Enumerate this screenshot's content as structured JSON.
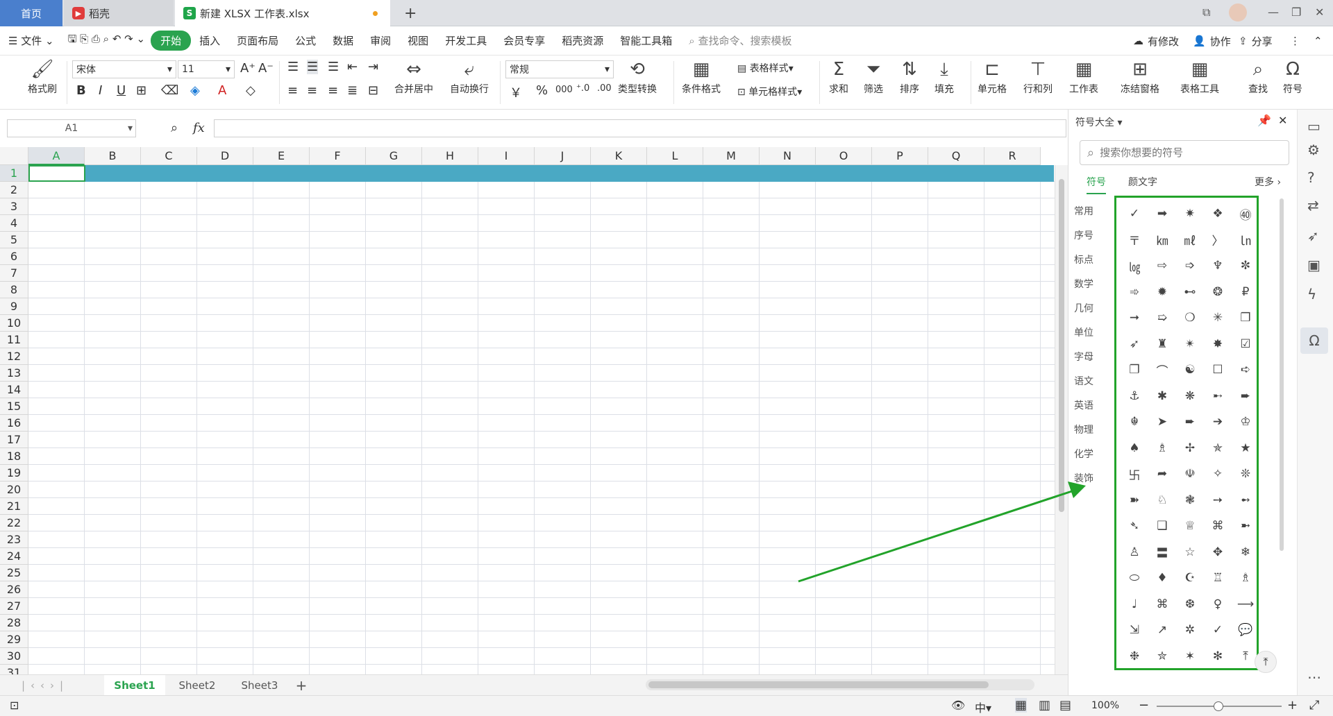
{
  "tabs": {
    "home": "首页",
    "daoke": "稻壳",
    "file": "新建 XLSX 工作表.xlsx",
    "add": "+"
  },
  "menu": {
    "file": "文件",
    "items": [
      "开始",
      "插入",
      "页面布局",
      "公式",
      "数据",
      "审阅",
      "视图",
      "开发工具",
      "会员专享",
      "稻壳资源",
      "智能工具箱"
    ],
    "search": "查找命令、搜索模板",
    "modified": "有修改",
    "collab": "协作",
    "share": "分享"
  },
  "ribbon": {
    "format_painter": "格式刷",
    "font": "宋体",
    "font_size": "11",
    "bold": "B",
    "italic": "I",
    "underline": "U",
    "merge": "合并居中",
    "wrap": "自动换行",
    "number_format": "常规",
    "yuan": "￥",
    "percent": "%",
    "thousands": "000",
    "type_convert": "类型转换",
    "cond_format": "条件格式",
    "table_style": "表格样式",
    "cell_style": "单元格样式",
    "sum": "求和",
    "filter": "筛选",
    "sort": "排序",
    "fill": "填充",
    "cell": "单元格",
    "rowcol": "行和列",
    "sheet": "工作表",
    "freeze": "冻结窗格",
    "table_tools": "表格工具",
    "find": "查找",
    "symbol": "符号"
  },
  "formula": {
    "name_box": "A1",
    "fx": "fx"
  },
  "columns": [
    "A",
    "B",
    "C",
    "D",
    "E",
    "F",
    "G",
    "H",
    "I",
    "J",
    "K",
    "L",
    "M",
    "N",
    "O",
    "P",
    "Q",
    "R"
  ],
  "rows": [
    "1",
    "2",
    "3",
    "4",
    "5",
    "6",
    "7",
    "8",
    "9",
    "10",
    "11",
    "12",
    "13",
    "14",
    "15",
    "16",
    "17",
    "18",
    "19",
    "20",
    "21",
    "22",
    "23",
    "24",
    "25",
    "26",
    "27",
    "28",
    "29",
    "30",
    "31"
  ],
  "sheets": [
    "Sheet1",
    "Sheet2",
    "Sheet3"
  ],
  "status": {
    "zoom": "100%"
  },
  "panel": {
    "title": "符号大全",
    "search_placeholder": "搜索你想要的符号",
    "tabs": [
      "符号",
      "颜文字"
    ],
    "more": "更多",
    "categories": [
      "常用",
      "序号",
      "标点",
      "数学",
      "几何",
      "单位",
      "字母",
      "语文",
      "英语",
      "物理",
      "化学",
      "装饰"
    ],
    "symbols": [
      "✓",
      "➡",
      "✷",
      "❖",
      "㊵",
      "〒",
      "㎞",
      "㎖",
      "〉",
      "㏑",
      "㏒",
      "⇨",
      "➩",
      "♆",
      "✼",
      "➾",
      "✹",
      "⊷",
      "❂",
      "₽",
      "➞",
      "➯",
      "❍",
      "✳",
      "❒",
      "➶",
      "♜",
      "✴",
      "✸",
      "☑",
      "❐",
      "⌒",
      "☯",
      "☐",
      "➪",
      "⚓",
      "✱",
      "❋",
      "➸",
      "➨",
      "☬",
      "➤",
      "➨",
      "➔",
      "♔",
      "♠",
      "♗",
      "✢",
      "✯",
      "★",
      "卐",
      "➦",
      "☫",
      "✧",
      "❊",
      "➽",
      "♘",
      "❃",
      "➙",
      "➻",
      "➴",
      "❑",
      "♕",
      "⌘",
      "➼",
      "♙",
      "〓",
      "☆",
      "✥",
      "❄",
      "⬭",
      "♦",
      "☪",
      "♖",
      "♗",
      "♩",
      "⌘",
      "❆",
      "♀",
      "⟶",
      "⇲",
      "↗",
      "✲",
      "✓",
      "💬",
      "❉",
      "✮",
      "✶",
      "✻",
      "⤒"
    ]
  },
  "colors": {
    "accent": "#2aa34f",
    "highlight_row": "#4aa9c4",
    "arrow": "#22a32a",
    "tab_blue": "#4a7fcd"
  }
}
